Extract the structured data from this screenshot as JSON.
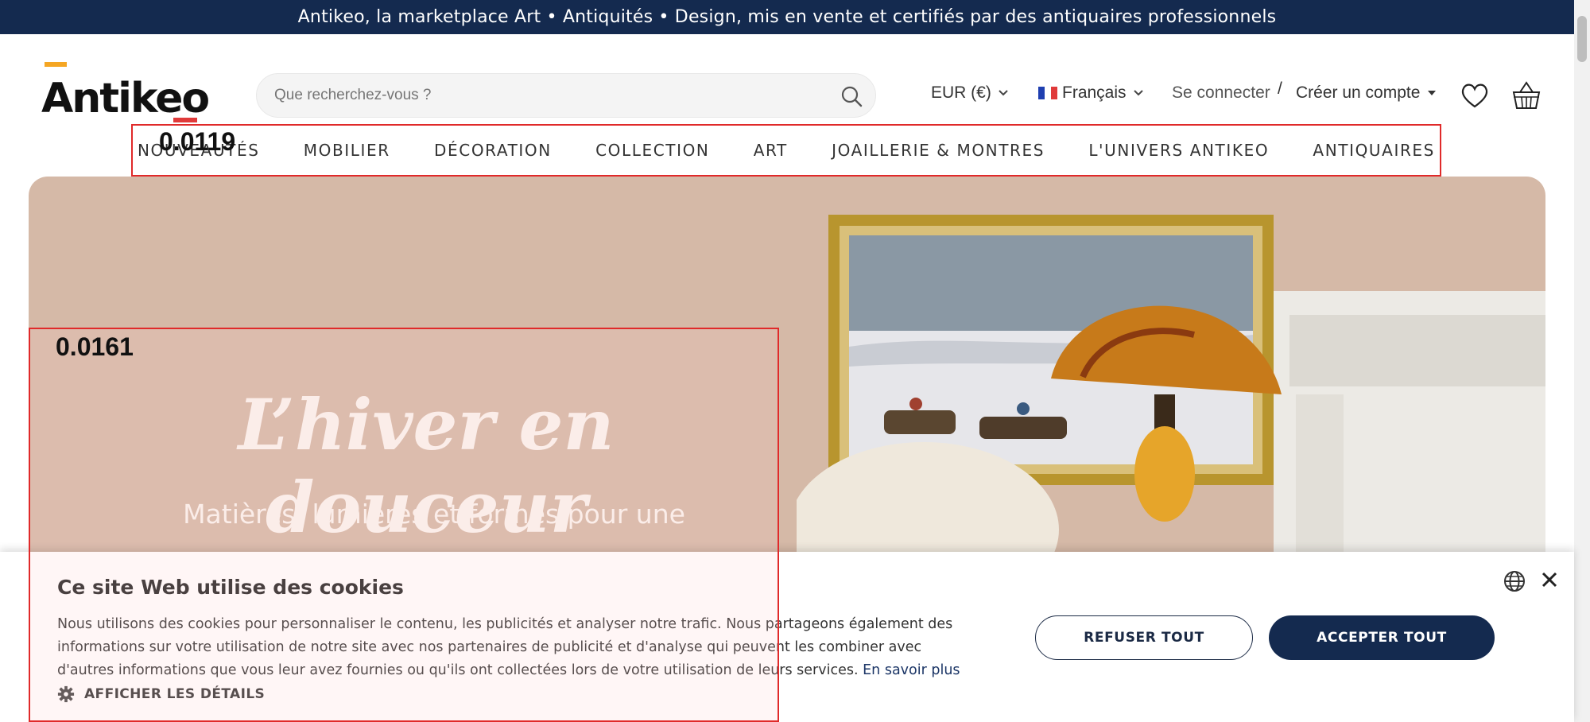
{
  "announcement": "Antikeo, la marketplace Art • Antiquités • Design, mis en vente et certifiés par des antiquaires professionnels",
  "brand": {
    "name": "Antikeo"
  },
  "search": {
    "placeholder": "Que recherchez-vous ?"
  },
  "header": {
    "currency": "EUR (€)",
    "language": "Français",
    "login": "Se connecter",
    "separator": "/",
    "register": "Créer un compte",
    "icons": [
      "heart-icon",
      "basket-icon"
    ]
  },
  "nav": {
    "items": [
      "NOUVEAUTÉS",
      "MOBILIER",
      "DÉCORATION",
      "COLLECTION",
      "ART",
      "JOAILLERIE & MONTRES",
      "L'UNIVERS ANTIKEO",
      "ANTIQUAIRES"
    ]
  },
  "hero": {
    "title": "L’hiver en douceur",
    "subtitle": "Matières, lumières et formes pour une"
  },
  "overlays": {
    "nav_score": "0.0119",
    "hero_score": "0.0161"
  },
  "cookie": {
    "title": "Ce site Web utilise des cookies",
    "text": "Nous utilisons des cookies pour personnaliser le contenu, les publicités et analyser notre trafic. Nous partageons également des informations sur votre utilisation de notre site avec nos partenaires de publicité et d'analyse qui peuvent les combiner avec d'autres informations que vous leur avez fournies ou qu'ils ont collectées lors de votre utilisation de leurs services.",
    "learn_more": "En savoir plus",
    "details": "AFFICHER LES DÉTAILS",
    "refuse": "REFUSER TOUT",
    "accept": "ACCEPTER TOUT"
  },
  "colors": {
    "navy": "#142a4f",
    "hero_bg": "#d5b9a7",
    "logo_accent": "#f5a623",
    "highlight_red": "#e02a2a"
  }
}
